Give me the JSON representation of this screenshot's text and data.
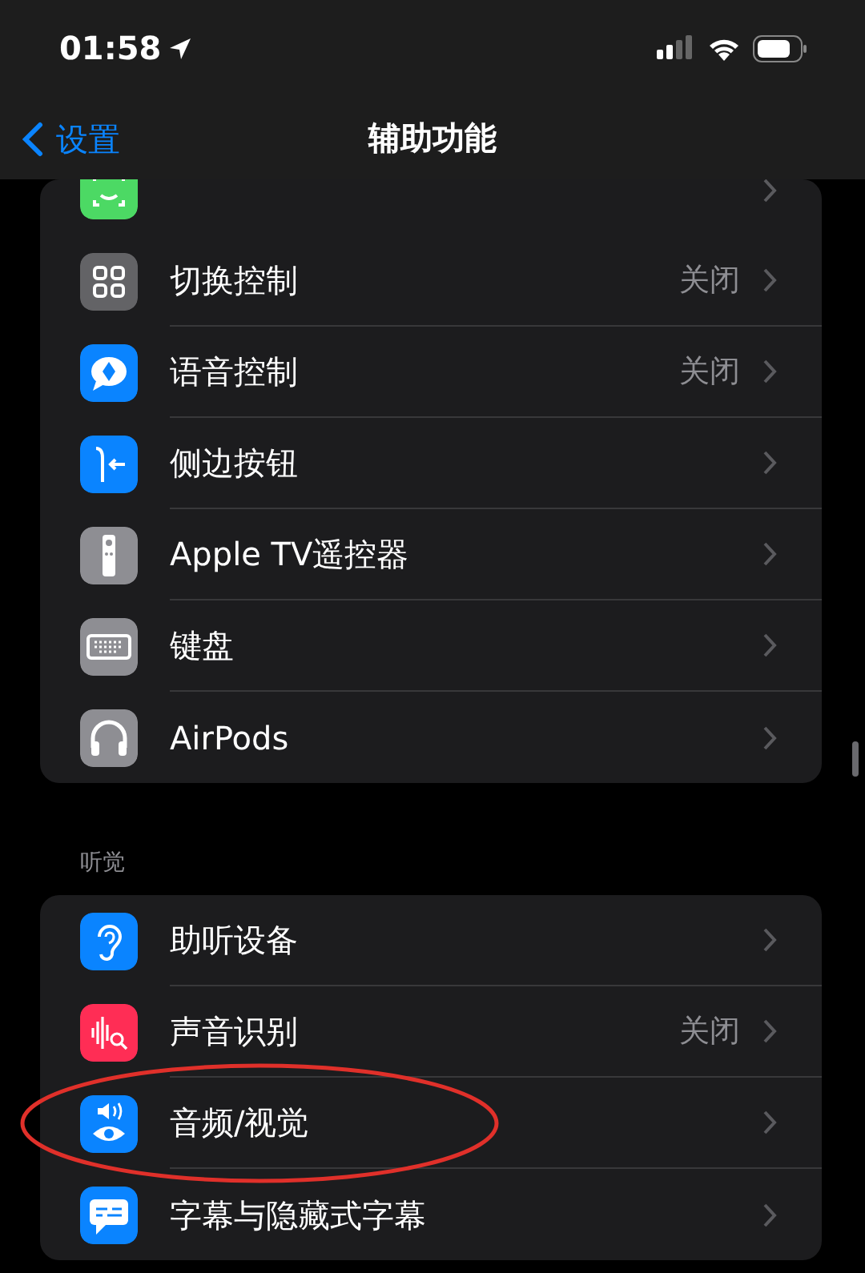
{
  "status_bar": {
    "time": "01:58"
  },
  "nav": {
    "back": "设置",
    "title": "辅助功能"
  },
  "groups": [
    {
      "items": [
        {
          "color": "#4cd964"
        },
        {
          "label": "切换控制",
          "value": "关闭",
          "color": "#636366"
        },
        {
          "label": "语音控制",
          "value": "关闭",
          "color": "#0a84ff"
        },
        {
          "label": "侧边按钮",
          "color": "#0a84ff"
        },
        {
          "label": "Apple TV遥控器",
          "color": "#8e8e93"
        },
        {
          "label": "键盘",
          "color": "#8e8e93"
        },
        {
          "label": "AirPods",
          "color": "#8e8e93"
        }
      ]
    },
    {
      "header": "听觉",
      "items": [
        {
          "label": "助听设备",
          "color": "#0a84ff",
          "circled": false
        },
        {
          "label": "声音识别",
          "value": "关闭",
          "color": "#ff2d55",
          "circled": false
        },
        {
          "label": "音频/视觉",
          "color": "#0a84ff",
          "circled": true
        },
        {
          "label": "字幕与隐藏式字幕",
          "color": "#0a84ff",
          "circled": false
        }
      ]
    }
  ]
}
